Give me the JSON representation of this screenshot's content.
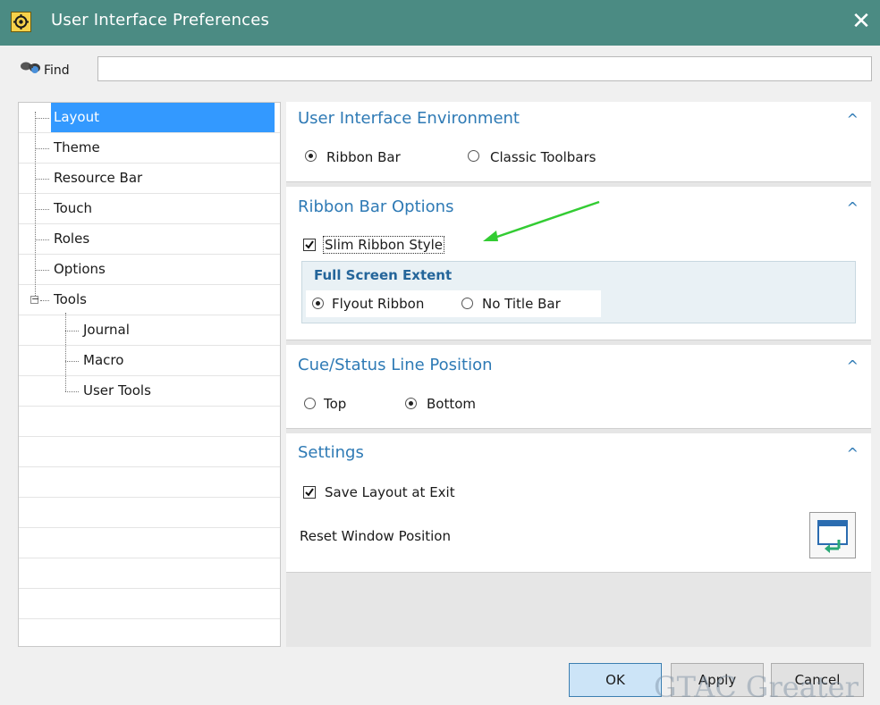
{
  "window": {
    "title": "User Interface Preferences",
    "close_glyph": "✕"
  },
  "find": {
    "label": "Find",
    "value": "",
    "placeholder": ""
  },
  "tree": {
    "items": [
      {
        "label": "Layout",
        "level": 0,
        "selected": true
      },
      {
        "label": "Theme",
        "level": 0
      },
      {
        "label": "Resource Bar",
        "level": 0
      },
      {
        "label": "Touch",
        "level": 0
      },
      {
        "label": "Roles",
        "level": 0
      },
      {
        "label": "Options",
        "level": 0
      },
      {
        "label": "Tools",
        "level": 0,
        "expanded": true
      },
      {
        "label": "Journal",
        "level": 1
      },
      {
        "label": "Macro",
        "level": 1
      },
      {
        "label": "User Tools",
        "level": 1
      }
    ]
  },
  "sections": {
    "ui_env": {
      "title": "User Interface Environment",
      "options": [
        {
          "label": "Ribbon Bar",
          "checked": true
        },
        {
          "label": "Classic Toolbars",
          "checked": false
        }
      ]
    },
    "ribbon": {
      "title": "Ribbon Bar Options",
      "slim_label": "Slim Ribbon Style",
      "slim_checked": true,
      "group_title": "Full Screen Extent",
      "options": [
        {
          "label": "Flyout Ribbon",
          "checked": true
        },
        {
          "label": "No Title Bar",
          "checked": false
        }
      ]
    },
    "cue": {
      "title": "Cue/Status Line Position",
      "options": [
        {
          "label": "Top",
          "checked": false
        },
        {
          "label": "Bottom",
          "checked": true
        }
      ]
    },
    "settings": {
      "title": "Settings",
      "save_label": "Save Layout at Exit",
      "save_checked": true,
      "reset_label": "Reset Window Position"
    }
  },
  "collapse_glyph": "^",
  "buttons": {
    "ok": "OK",
    "apply": "Apply",
    "cancel": "Cancel"
  },
  "annotation_color": "#33cc33",
  "watermark": "GTAC Greater"
}
